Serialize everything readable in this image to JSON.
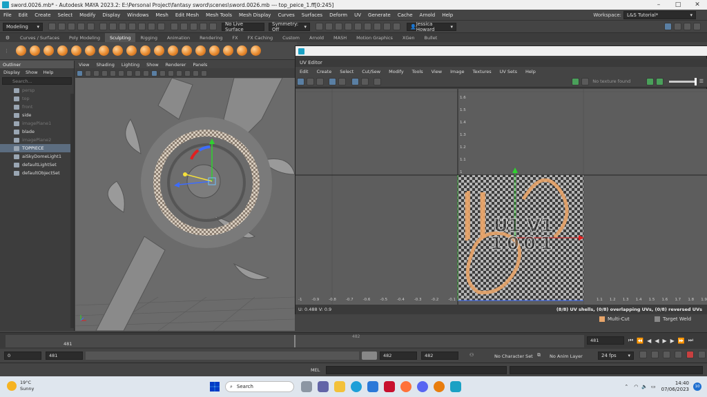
{
  "window": {
    "title": "sword.0026.mb* - Autodesk MAYA 2023.2: E:\\Personal Project\\fantasy sword\\scenes\\sword.0026.mb   ---   top_peice_1.ff[0:245]"
  },
  "menubar": {
    "items": [
      "File",
      "Edit",
      "Create",
      "Select",
      "Modify",
      "Display",
      "Windows",
      "Mesh",
      "Edit Mesh",
      "Mesh Tools",
      "Mesh Display",
      "Curves",
      "Surfaces",
      "Deform",
      "UV",
      "Generate",
      "Cache",
      "Arnold",
      "Help"
    ],
    "workspace_label": "Workspace:",
    "workspace_value": "L&S Tutorial*"
  },
  "statusline": {
    "mode": "Modeling",
    "live_surface": "No Live Surface",
    "symmetry": "Symmetry: Off",
    "user": "Jessica Howard"
  },
  "shelf": {
    "tabs": [
      "Curves / Surfaces",
      "Poly Modeling",
      "Sculpting",
      "Rigging",
      "Animation",
      "Rendering",
      "FX",
      "FX Caching",
      "Custom",
      "Arnold",
      "MASH",
      "Motion Graphics",
      "XGen",
      "Bullet"
    ],
    "active_tab": "Sculpting",
    "tool_count": 18
  },
  "outliner": {
    "title": "Outliner",
    "menu": [
      "Display",
      "Show",
      "Help"
    ],
    "search_placeholder": "Search...",
    "items": [
      {
        "label": "persp",
        "state": "dim"
      },
      {
        "label": "top",
        "state": "dim"
      },
      {
        "label": "front",
        "state": "dim"
      },
      {
        "label": "side",
        "state": "normal"
      },
      {
        "label": "imagePlane1",
        "state": "dim"
      },
      {
        "label": "blade",
        "state": "normal"
      },
      {
        "label": "imagePlane2",
        "state": "dim"
      },
      {
        "label": "TOPPIECE",
        "state": "selected"
      },
      {
        "label": "aiSkyDomeLight1",
        "state": "normal"
      },
      {
        "label": "defaultLightSet",
        "state": "normal"
      },
      {
        "label": "defaultObjectSet",
        "state": "normal"
      }
    ]
  },
  "viewport": {
    "menu": [
      "View",
      "Shading",
      "Lighting",
      "Show",
      "Renderer",
      "Panels"
    ]
  },
  "uv_editor": {
    "title": "UV Editor",
    "menu": [
      "Edit",
      "Create",
      "Select",
      "Cut/Sew",
      "Modify",
      "Tools",
      "View",
      "Image",
      "Textures",
      "UV Sets",
      "Help"
    ],
    "texture_label": "No texture found",
    "tile_label_1": "U1 V1",
    "tile_label_2": "1001",
    "coords": "U:  0.488  V:  0.9",
    "stats": "(8/8) UV shells, (0/8) overlapping UVs, (0/8) reversed UVs",
    "left_ticks": [
      "-1",
      "-0.9",
      "-0.8",
      "-0.7",
      "-0.6",
      "-0.5",
      "-0.4",
      "-0.3",
      "-0.2",
      "-0.1"
    ],
    "right_ticks": [
      "1.1",
      "1.2",
      "1.3",
      "1.4",
      "1.5",
      "1.6",
      "1.7",
      "1.8",
      "1.9"
    ],
    "v_ticks": [
      "1.6",
      "1.5",
      "1.4",
      "1.3",
      "1.2",
      "1.1",
      "1",
      "-0.1"
    ],
    "modeling_toolkit": [
      "Multi-Cut",
      "Target Weld"
    ]
  },
  "timeline": {
    "current_frame": "481",
    "marker_frame": "482",
    "frame_field": "481"
  },
  "range": {
    "start": "0",
    "current": "481",
    "range_start": "482",
    "range_end": "482",
    "character_set": "No Character Set",
    "anim_layer": "No Anim Layer",
    "fps": "24 fps"
  },
  "mel": {
    "label": "MEL"
  },
  "taskbar": {
    "weather_temp": "19°C",
    "weather_desc": "Sunny",
    "search": "Search",
    "time": "14:40",
    "date": "07/06/2023",
    "notifications": "10"
  },
  "colors": {
    "maya_bg": "#444444",
    "accent_orange": "#e88a2e",
    "selection_blue": "#5c6d80"
  }
}
